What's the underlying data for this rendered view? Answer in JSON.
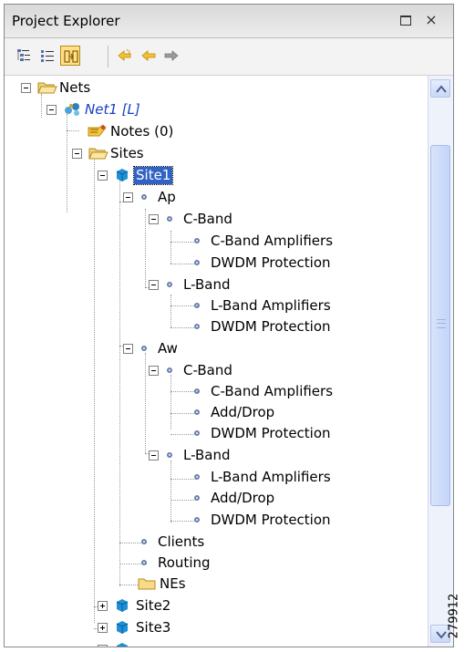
{
  "panel": {
    "title": "Project Explorer",
    "close_glyph": "×",
    "maximize_icon": "maximize-icon"
  },
  "toolbar": {
    "buttons": [
      {
        "name": "tree-view-icon",
        "toggled": false
      },
      {
        "name": "list-view-icon",
        "toggled": false
      },
      {
        "name": "link-with-editor-icon",
        "toggled": true
      },
      {
        "name": "up-arrow-icon",
        "toggled": false
      },
      {
        "name": "back-arrow-icon",
        "toggled": false
      },
      {
        "name": "forward-arrow-icon",
        "toggled": false
      }
    ]
  },
  "tree": {
    "nets": "Nets",
    "net1": "Net1 [L]",
    "notes": "Notes (0)",
    "sites": "Sites",
    "site1": "Site1",
    "ap": "Ap",
    "ap_cband": "C-Band",
    "ap_cband_amps": "C-Band Amplifiers",
    "ap_cband_dwdm": "DWDM Protection",
    "ap_lband": "L-Band",
    "ap_lband_amps": "L-Band Amplifiers",
    "ap_lband_dwdm": "DWDM Protection",
    "aw": "Aw",
    "aw_cband": "C-Band",
    "aw_cband_amps": "C-Band Amplifiers",
    "aw_cband_adddrop": "Add/Drop",
    "aw_cband_dwdm": "DWDM Protection",
    "aw_lband": "L-Band",
    "aw_lband_amps": "L-Band Amplifiers",
    "aw_lband_adddrop": "Add/Drop",
    "aw_lband_dwdm": "DWDM Protection",
    "clients": "Clients",
    "routing": "Routing",
    "nes": "NEs",
    "site2": "Site2",
    "site3": "Site3"
  },
  "figure_id": "279912",
  "colors": {
    "selection": "#3162c5",
    "net_link": "#1a3fc8",
    "toggle_bg": "#ffe08a",
    "scrollbar": "#c9d8f6"
  }
}
